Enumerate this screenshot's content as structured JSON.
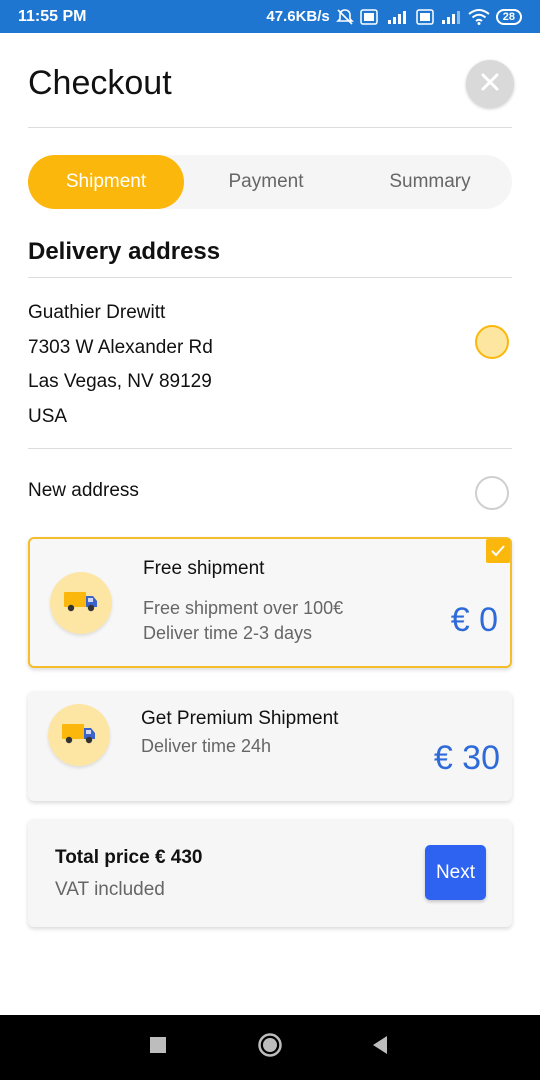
{
  "status_bar": {
    "time": "11:55 PM",
    "network_speed": "47.6KB/s",
    "battery": "28",
    "icons": [
      "mute-icon",
      "volte-icon",
      "signal-4g-icon",
      "volte-icon",
      "signal-icon",
      "wifi-icon",
      "battery-icon"
    ]
  },
  "header": {
    "title": "Checkout",
    "close_icon": "close-icon"
  },
  "tabs": [
    {
      "label": "Shipment",
      "active": true
    },
    {
      "label": "Payment",
      "active": false
    },
    {
      "label": "Summary",
      "active": false
    }
  ],
  "delivery": {
    "title": "Delivery address",
    "address_lines": [
      "Guathier Drewitt",
      "7303 W Alexander Rd",
      "Las Vegas, NV 89129",
      "USA"
    ],
    "address_selected": true,
    "new_address_label": "New address",
    "new_address_selected": false
  },
  "shipping_options": [
    {
      "title": "Free shipment",
      "lines": [
        "Free shipment over 100€",
        "Deliver time 2-3 days"
      ],
      "price": "€ 0",
      "selected": true,
      "icon": "truck-icon"
    },
    {
      "title": "Get Premium Shipment",
      "lines": [
        "Deliver time 24h"
      ],
      "price": "€ 30",
      "selected": false,
      "icon": "truck-icon"
    }
  ],
  "total": {
    "label": "Total price € 430",
    "vat": "VAT included",
    "next_label": "Next"
  },
  "colors": {
    "accent": "#fbb70c",
    "price": "#2f6bd8",
    "next_button": "#2e63f2",
    "status_bar": "#1e76d0"
  }
}
